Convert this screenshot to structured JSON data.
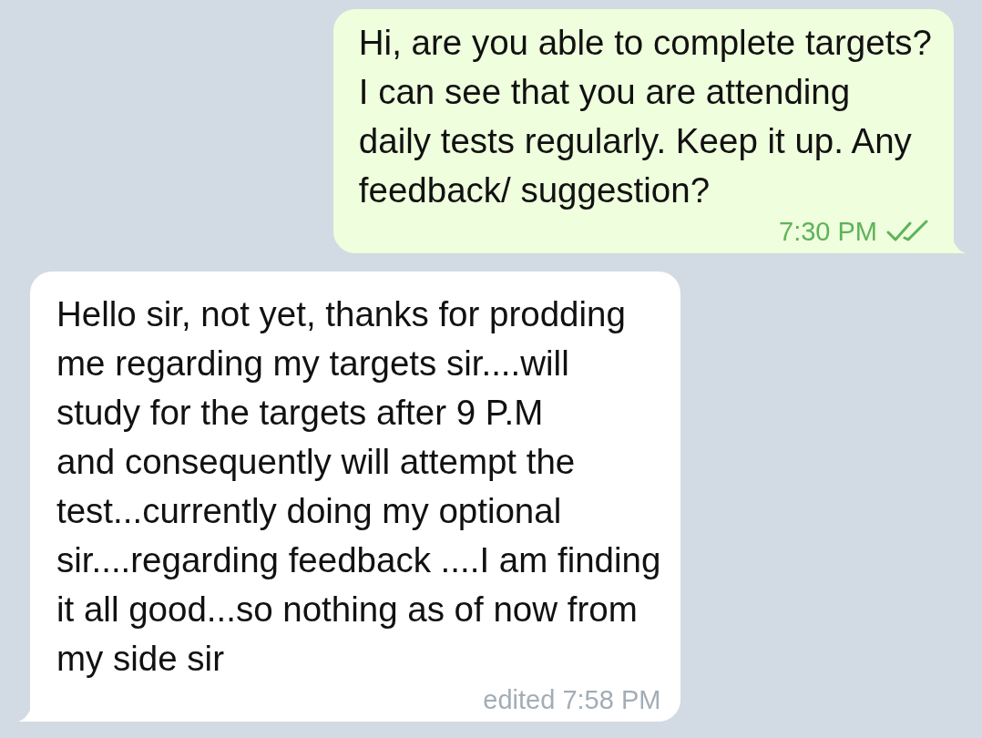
{
  "messages": [
    {
      "kind": "outgoing",
      "text": "Hi, are you able to complete targets?\nI can see that you are attending\ndaily tests regularly. Keep it up. Any\nfeedback/ suggestion?",
      "time": "7:30 PM",
      "read": true
    },
    {
      "kind": "incoming",
      "text": "Hello sir, not yet, thanks for prodding\nme regarding my targets sir....will\nstudy for the targets after 9 P.M\nand consequently will attempt the\ntest...currently doing my optional\nsir....regarding feedback ....I am finding\nit all good...so nothing as of now from\nmy side sir",
      "time": "edited 7:58 PM"
    }
  ]
}
